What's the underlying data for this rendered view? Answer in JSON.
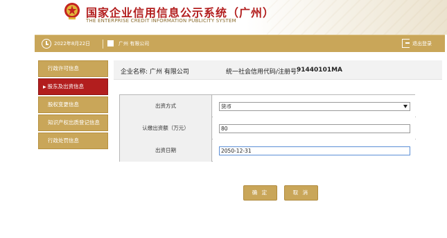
{
  "header": {
    "title": "国家企业信用信息公示系统（广州）",
    "subtitle": "THE ENTERPRISE CREDIT INFORMATION PUBLICITY SYSTEM"
  },
  "topbar": {
    "date": "2022年8月22日",
    "company": "广州          有限公司",
    "logout": "退出登录"
  },
  "sidebar": {
    "items": [
      {
        "label": "行政许可信息",
        "active": false
      },
      {
        "label": "股东及出资信息",
        "active": true
      },
      {
        "label": "股权变更信息",
        "active": false
      },
      {
        "label": "知识产权出质登记信息",
        "active": false
      },
      {
        "label": "行政处罚信息",
        "active": false
      }
    ]
  },
  "info": {
    "company_label": "企业名称:",
    "company_name": "广州                有限公司",
    "code_label": "统一社会信用代码/注册号:",
    "code_value": "91440101MA"
  },
  "form": {
    "method_label": "出资方式",
    "method_value": "货币",
    "amount_label": "认缴出资额（万元）",
    "amount_value": "80",
    "date_label": "出资日期",
    "date_value": "2050-12-31"
  },
  "buttons": {
    "ok": "确 定",
    "cancel": "取 消"
  },
  "colors": {
    "gold": "#c9a659",
    "active_red": "#b21e1e"
  }
}
